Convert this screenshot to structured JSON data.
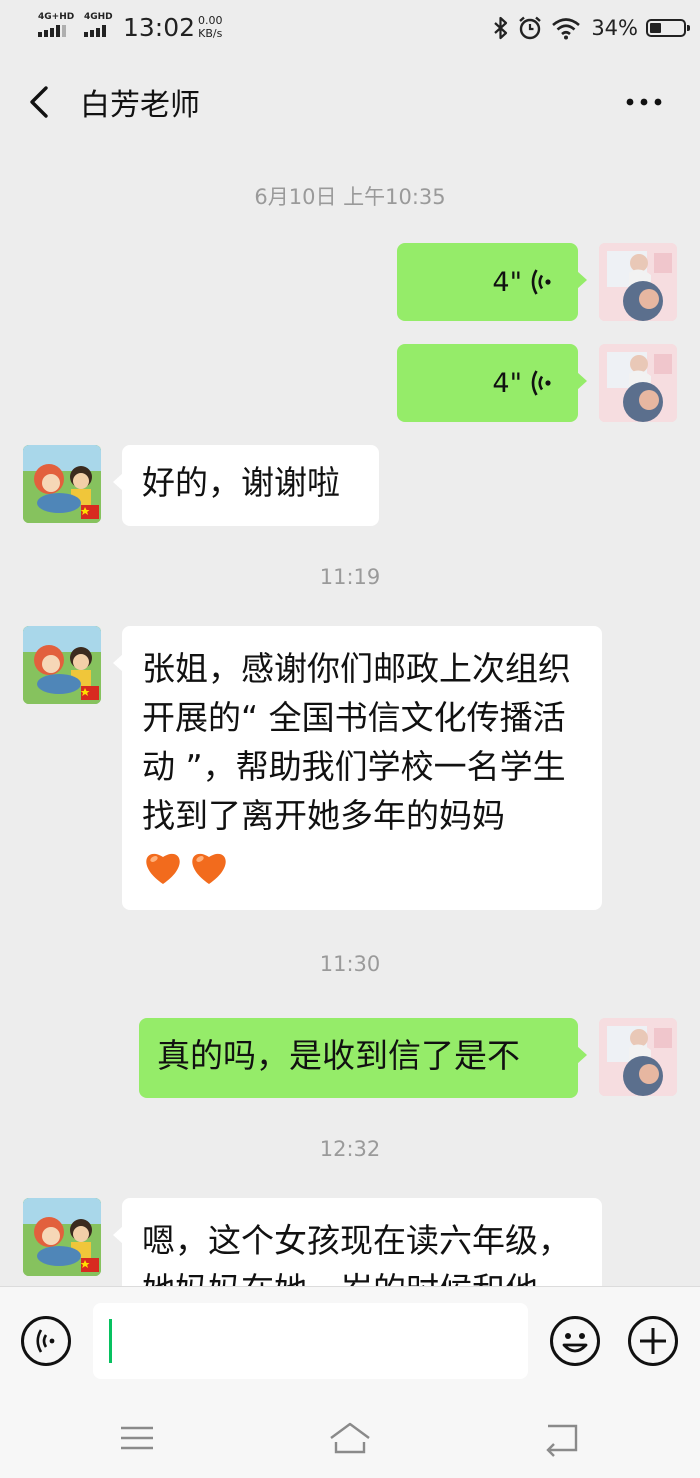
{
  "status": {
    "net1": "4G+HD",
    "net2": "4GHD",
    "time": "13:02",
    "speed_value": "0.00",
    "speed_unit": "KB/s",
    "battery": "34%",
    "battery_level": 0.34,
    "icons": [
      "bluetooth-icon",
      "alarm-icon",
      "wifi-icon",
      "battery-icon"
    ]
  },
  "header": {
    "title": "白芳老师",
    "icons": [
      "back-chevron-icon",
      "more-dots-icon"
    ]
  },
  "messages": {
    "ts1": "6月10日 上午10:35",
    "voice1": "4\"",
    "voice2": "4\"",
    "m1": "好的，谢谢啦",
    "ts2": "11:19",
    "m2": "张姐，感谢你们邮政上次组织开展的“ 全国书信文化传播活动 ”，帮助我们学校一名学生找到了离开她多年的妈妈",
    "ts3": "11:30",
    "m3": "真的吗，是收到信了是不",
    "ts4": "12:32",
    "m4": "嗯，这个女孩现在读六年级，她妈妈在她一岁的时候和他"
  },
  "inputbar": {
    "value": "",
    "icons": [
      "voice-mode-icon",
      "emoji-icon",
      "plus-icon"
    ]
  },
  "navbar": {
    "icons": [
      "menu-icon",
      "home-icon",
      "back-icon"
    ]
  },
  "colors": {
    "bg": "#ededed",
    "bubble_self": "#95ec69",
    "bubble_other": "#ffffff",
    "timestamp": "#9a9a9a",
    "cursor": "#07c160"
  }
}
